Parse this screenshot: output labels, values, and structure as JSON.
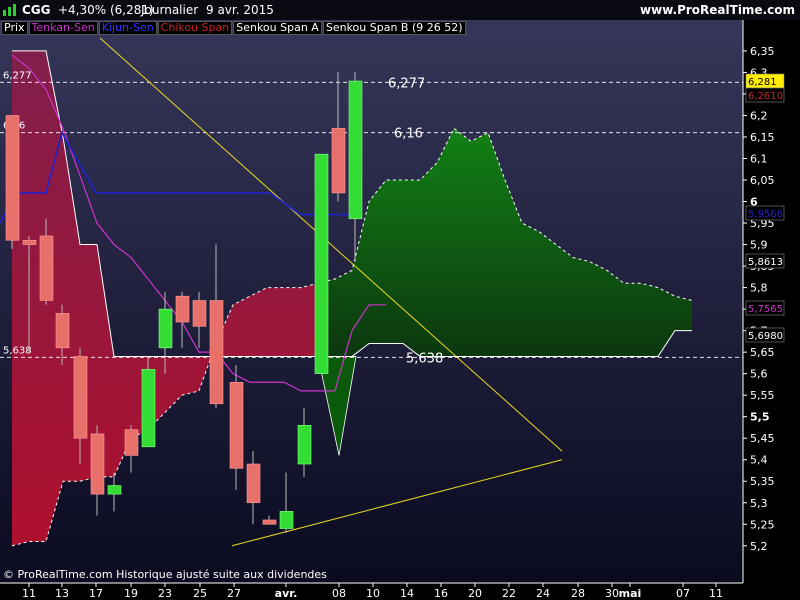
{
  "header": {
    "symbol": "CGG",
    "change": "+4,30% (6,281)",
    "period": "Journalier",
    "date": "9 avr. 2015",
    "site": "www.ProRealTime.com"
  },
  "legend": [
    {
      "label": "Prix",
      "color": "#ffffff"
    },
    {
      "label": "Tenkan-Sen",
      "color": "#cc33cc"
    },
    {
      "label": "Kijun-Sen",
      "color": "#3333ff"
    },
    {
      "label": "Chikou Span",
      "color": "#cc2222"
    },
    {
      "label": "Senkou Span A",
      "color": "#ffffff"
    },
    {
      "label": "Senkou Span B (9 26 52)",
      "color": "#ffffff"
    }
  ],
  "footer": "© ProRealTime.com  Historique ajusté suite aux dividendes",
  "colors": {
    "up": "#33dd33",
    "down": "#e8706a",
    "tenkan": "#cc33cc",
    "kijun": "#2222cc",
    "cloud_bull": "#117711",
    "cloud_bear": "#8a1040",
    "trendline": "#e8d820",
    "bg_top": "#36365a",
    "bg_bottom": "#0a0a20"
  },
  "chart_data": {
    "type": "candlestick",
    "y_axis": {
      "range": [
        5.16,
        6.38
      ],
      "ticks": [
        "6,35",
        "6,3",
        "6,25",
        "6,2",
        "6,15",
        "6,1",
        "6,05",
        "6",
        "5,95",
        "5,9",
        "5,85",
        "5,8",
        "5,75",
        "5,7",
        "5,65",
        "5,6",
        "5,55",
        "5,5",
        "5,45",
        "5,4",
        "5,35",
        "5,3",
        "5,25",
        "5,2"
      ],
      "emphasized_ticks": [
        "6",
        "5,5"
      ]
    },
    "x_axis": {
      "ticks": [
        "11",
        "13",
        "17",
        "19",
        "23",
        "25",
        "27",
        "avr.",
        "08",
        "10",
        "14",
        "16",
        "20",
        "22",
        "24",
        "28",
        "30",
        "mai",
        "07",
        "11"
      ],
      "emphasized_ticks": [
        "avr.",
        "mai"
      ]
    },
    "candles": [
      {
        "date": "11",
        "open": 6.2,
        "high": 6.2,
        "low": 5.89,
        "close": 5.91
      },
      {
        "date": "12",
        "open": 5.91,
        "high": 5.92,
        "low": 5.65,
        "close": 5.9
      },
      {
        "date": "13",
        "open": 5.92,
        "high": 5.96,
        "low": 5.76,
        "close": 5.77
      },
      {
        "date": "16",
        "open": 5.74,
        "high": 5.76,
        "low": 5.62,
        "close": 5.66
      },
      {
        "date": "17",
        "open": 5.64,
        "high": 5.66,
        "low": 5.39,
        "close": 5.45
      },
      {
        "date": "18",
        "open": 5.46,
        "high": 5.48,
        "low": 5.27,
        "close": 5.32
      },
      {
        "date": "19",
        "open": 5.32,
        "high": 5.37,
        "low": 5.28,
        "close": 5.34
      },
      {
        "date": "20",
        "open": 5.47,
        "high": 5.48,
        "low": 5.37,
        "close": 5.41
      },
      {
        "date": "23",
        "open": 5.43,
        "high": 5.64,
        "low": 5.43,
        "close": 5.61
      },
      {
        "date": "24",
        "open": 5.66,
        "high": 5.79,
        "low": 5.6,
        "close": 5.75
      },
      {
        "date": "25",
        "open": 5.78,
        "high": 5.79,
        "low": 5.66,
        "close": 5.72
      },
      {
        "date": "26",
        "open": 5.77,
        "high": 5.79,
        "low": 5.66,
        "close": 5.71
      },
      {
        "date": "27",
        "open": 5.77,
        "high": 5.9,
        "low": 5.52,
        "close": 5.53
      },
      {
        "date": "30",
        "open": 5.58,
        "high": 5.62,
        "low": 5.33,
        "close": 5.38
      },
      {
        "date": "31",
        "open": 5.39,
        "high": 5.42,
        "low": 5.25,
        "close": 5.3
      },
      {
        "date": "01",
        "open": 5.26,
        "high": 5.27,
        "low": 5.25,
        "close": 5.25
      },
      {
        "date": "02",
        "open": 5.24,
        "high": 5.37,
        "low": 5.23,
        "close": 5.28
      },
      {
        "date": "07",
        "open": 5.39,
        "high": 5.52,
        "low": 5.36,
        "close": 5.48
      },
      {
        "date": "08",
        "open": 5.6,
        "high": 6.1,
        "low": 5.6,
        "close": 6.11
      },
      {
        "date": "08b",
        "open": 6.17,
        "high": 6.3,
        "low": 6.0,
        "close": 6.02
      },
      {
        "date": "09",
        "open": 5.96,
        "high": 6.3,
        "low": 5.86,
        "close": 6.28
      }
    ],
    "tenkan": [
      6.34,
      6.31,
      6.26,
      6.17,
      6.06,
      5.95,
      5.9,
      5.87,
      5.82,
      5.77,
      5.72,
      5.65,
      5.65,
      5.6,
      5.58,
      5.58,
      5.58,
      5.56,
      5.56,
      5.56,
      5.7,
      5.76,
      5.76
    ],
    "kijun": [
      5.95,
      6.02,
      6.02,
      6.16,
      6.02,
      6.02,
      6.02,
      6.02,
      6.02,
      6.02,
      6.02,
      6.02,
      5.97,
      5.97,
      5.96
    ],
    "senkou_a": [
      5.2,
      5.21,
      5.21,
      5.35,
      5.35,
      5.36,
      5.36,
      5.45,
      5.47,
      5.51,
      5.55,
      5.56,
      5.67,
      5.76,
      5.78,
      5.8,
      5.8,
      5.8,
      5.81,
      5.82,
      5.84,
      6.0,
      6.05,
      6.05,
      6.05,
      6.09,
      6.17,
      6.14,
      6.16,
      6.05,
      5.95,
      5.93,
      5.9,
      5.87,
      5.86,
      5.84,
      5.81,
      5.81,
      5.8,
      5.78,
      5.77
    ],
    "senkou_b": [
      6.35,
      6.35,
      6.35,
      6.15,
      5.9,
      5.9,
      5.64,
      5.64,
      5.64,
      5.64,
      5.64,
      5.64,
      5.64,
      5.64,
      5.64,
      5.64,
      5.64,
      5.64,
      5.64,
      5.64,
      5.64,
      5.67,
      5.67,
      5.67
    ],
    "chikou_area": "Chikou Span",
    "horizontal_levels": [
      {
        "value": 6.277,
        "label": "6,277"
      },
      {
        "value": 6.16,
        "label": "6,16"
      },
      {
        "value": 5.638,
        "label": "5,638"
      }
    ],
    "level_annotations": [
      "6,277",
      "6,16",
      "5,638"
    ],
    "price_tags": [
      {
        "value": 6.281,
        "label": "6,281",
        "bg": "#ffee00",
        "fg": "#000000"
      },
      {
        "value": 6.261,
        "label": "6,2610",
        "bg": "#000000",
        "fg": "#cc2222"
      },
      {
        "value": 5.9566,
        "label": "5,9566",
        "bg": "#000000",
        "fg": "#2222cc"
      },
      {
        "value": 5.8613,
        "label": "5,8613",
        "bg": "#000000",
        "fg": "#ffffff"
      },
      {
        "value": 5.7565,
        "label": "5,7565",
        "bg": "#000000",
        "fg": "#cc33cc"
      },
      {
        "value": 5.698,
        "label": "5,6980",
        "bg": "#000000",
        "fg": "#ffffff"
      }
    ],
    "trendlines": [
      {
        "from": [
          6.38,
          "11"
        ],
        "to": [
          5.42,
          "28"
        ]
      },
      {
        "from": [
          5.2,
          "01"
        ],
        "to": [
          5.4,
          "28"
        ]
      }
    ]
  }
}
